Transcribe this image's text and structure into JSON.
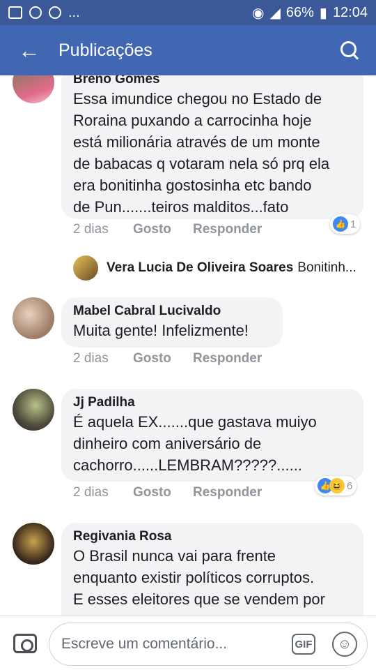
{
  "status_bar": {
    "time": "12:04",
    "battery": "66%",
    "more": "..."
  },
  "app_bar": {
    "title": "Publicações"
  },
  "comments": [
    {
      "author": "Breno Gomes",
      "lines": [
        "Essa imundice chegou no Estado de",
        "Roraina puxando a carrocinha hoje",
        "está  milionária através de um monte",
        "de babacas q votaram nela só prq ela",
        "era bonitinha gostosinha etc bando",
        "de Pun.......teiros malditos...fato"
      ],
      "time": "2 dias",
      "like": "Gosto",
      "reply": "Responder",
      "reaction_count": "1"
    },
    {
      "author": "Mabel Cabral Lucivaldo",
      "lines": [
        "Muita gente! Infelizmente!"
      ],
      "time": "2 dias",
      "like": "Gosto",
      "reply": "Responder"
    },
    {
      "author": "Jj Padilha",
      "lines": [
        "É aquela EX.......que gastava muiyo",
        "dinheiro com aniversário de",
        "cachorro......LEMBRAM?????......"
      ],
      "time": "2 dias",
      "like": "Gosto",
      "reply": "Responder",
      "reaction_count": "6"
    },
    {
      "author": "Regivania Rosa",
      "lines": [
        "O Brasil nunca vai para frente",
        "enquanto existir políticos corruptos.",
        "E esses eleitores que se vendem por"
      ]
    }
  ],
  "reply_preview": {
    "author": "Vera Lucia De Oliveira Soares",
    "text": "Bonitinh..."
  },
  "composer": {
    "placeholder": "Escreve um comentário...",
    "gif": "GIF"
  },
  "colors": {
    "brand": "#4267b2",
    "status": "#3b5998",
    "bubble": "#f2f3f5",
    "like": "#3b8af3"
  }
}
